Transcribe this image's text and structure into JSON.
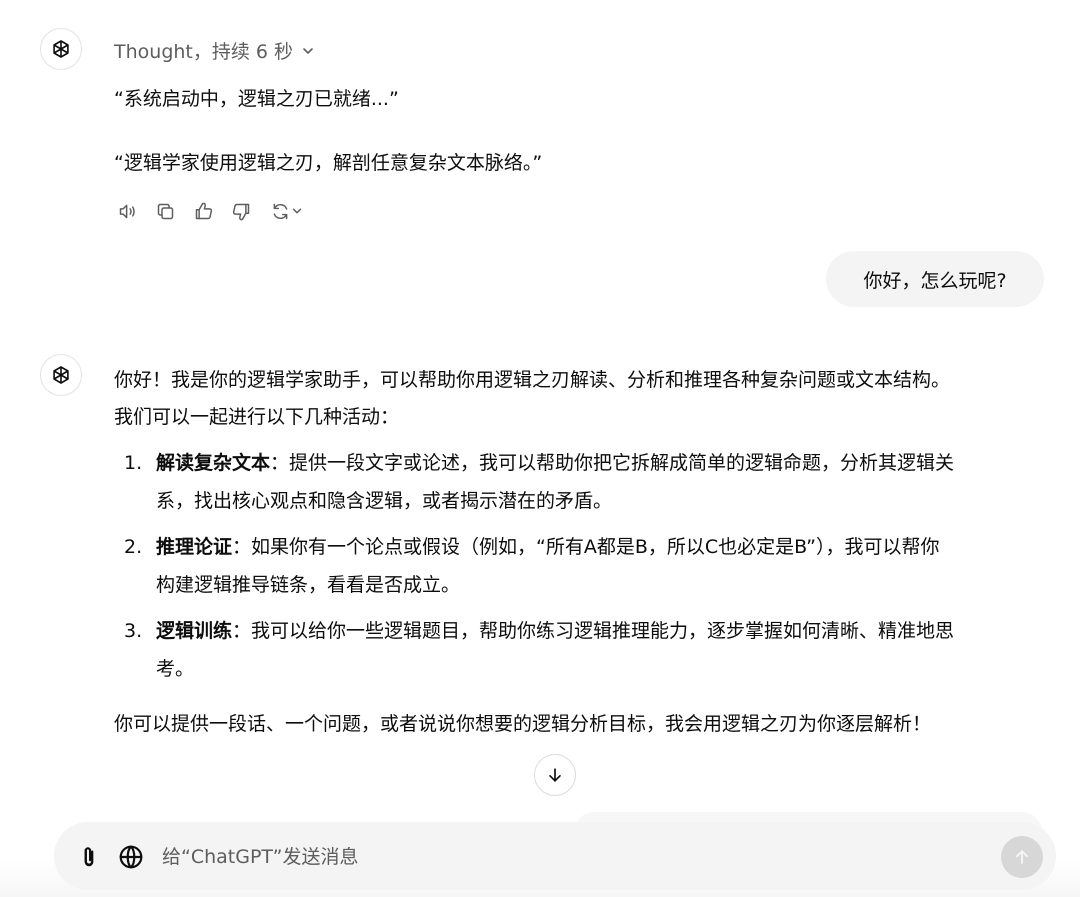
{
  "thought": {
    "label": "Thought，持续 6 秒"
  },
  "first_reply": {
    "line1": "“系统启动中，逻辑之刃已就绪...”",
    "line2": "“逻辑学家使用逻辑之刃，解剖任意复杂文本脉络。”"
  },
  "message_actions": [
    "read-aloud",
    "copy",
    "thumbs-up",
    "thumbs-down",
    "regenerate"
  ],
  "user_message": "你好，怎么玩呢?",
  "answer": {
    "intro_line1": "你好！我是你的逻辑学家助手，可以帮助你用逻辑之刃解读、分析和推理各种复杂问题或文本结构。",
    "intro_line2": "我们可以一起进行以下几种活动：",
    "items": [
      {
        "num": "1.",
        "title": "解读复杂文本",
        "line1": "：提供一段文字或论述，我可以帮助你把它拆解成简单的逻辑命题，分析其逻辑关",
        "line2": "系，找出核心观点和隐含逻辑，或者揭示潜在的矛盾。"
      },
      {
        "num": "2.",
        "title": "推理论证",
        "line1": "：如果你有一个论点或假设（例如，“所有A都是B，所以C也必定是B”），我可以帮你",
        "line2": "构建逻辑推导链条，看看是否成立。"
      },
      {
        "num": "3.",
        "title": "逻辑训练",
        "line1": "：我可以给你一些逻辑题目，帮助你练习逻辑推理能力，逐步掌握如何清晰、精准地思",
        "line2": "考。"
      }
    ],
    "closing": "你可以提供一段话、一个问题，或者说说你想要的逻辑分析目标，我会用逻辑之刃为你逐层解析！"
  },
  "composer": {
    "placeholder": "给“ChatGPT”发送消息",
    "value": ""
  }
}
